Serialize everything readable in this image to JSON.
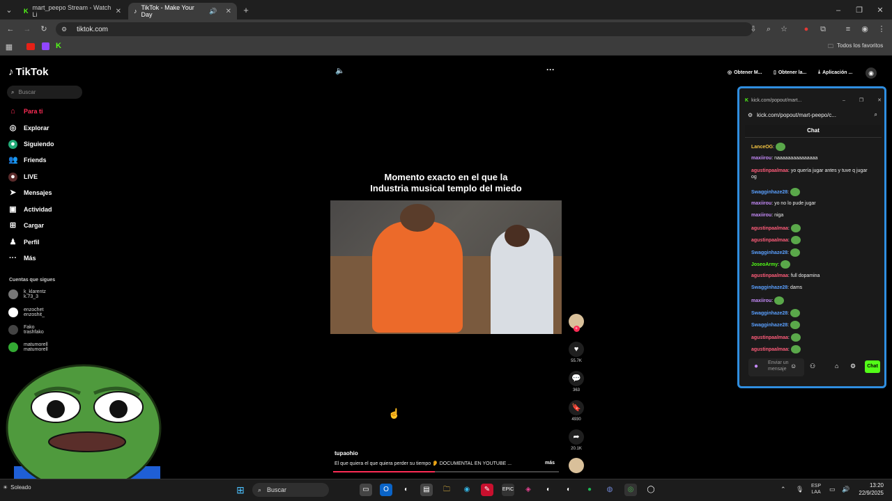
{
  "browser": {
    "tabs": [
      {
        "title": "mart_peepo Stream - Watch Li"
      },
      {
        "title": "TikTok - Make Your Day"
      }
    ],
    "url": "tiktok.com",
    "bookmarks_right": "Todos los favoritos"
  },
  "tiktok": {
    "logo": "TikTok",
    "search_placeholder": "Buscar",
    "nav": [
      {
        "label": "Para ti",
        "icon": "home-icon"
      },
      {
        "label": "Explorar",
        "icon": "compass-icon"
      },
      {
        "label": "Siguiendo",
        "icon": "following-icon"
      },
      {
        "label": "Friends",
        "icon": "friends-icon"
      },
      {
        "label": "LIVE",
        "icon": "live-icon"
      },
      {
        "label": "Mensajes",
        "icon": "messages-icon"
      },
      {
        "label": "Actividad",
        "icon": "activity-icon"
      },
      {
        "label": "Cargar",
        "icon": "upload-icon"
      },
      {
        "label": "Perfil",
        "icon": "profile-icon"
      },
      {
        "label": "Más",
        "icon": "more-icon"
      }
    ],
    "following_header": "Cuentas que sigues",
    "following": [
      {
        "name": "k_klarentz",
        "handle": "k.73_3"
      },
      {
        "name": "enzochet",
        "handle": "enzoshit_"
      },
      {
        "name": "Fako",
        "handle": "trashfako"
      },
      {
        "name": "matumorell",
        "handle": "matumorell"
      }
    ],
    "top_chips": [
      "Obtener M...",
      "Obtener la...",
      "Aplicación ..."
    ],
    "video": {
      "caption_line1": "Momento exacto en el que la",
      "caption_line2": "Industria musical templo del miedo",
      "author": "tupaohio",
      "description": "El que quiera el que quiera perder su tiempo 👂 DOCUMENTAL EN YOUTUBE ...",
      "more": "más",
      "likes": "55.7K",
      "comments": "363",
      "saves": "4930",
      "shares": "20.1K",
      "progress": 0.45
    }
  },
  "kick_popup": {
    "title": "kick.com/popout/mart...",
    "url": "kick.com/popout/mart-peepo/c...",
    "chat_title": "Chat",
    "messages": [
      {
        "user": "LanceOG",
        "text": "",
        "color": "#f5c542"
      },
      {
        "user": "maxiirou",
        "text": "naaaaaaaaaaaaaaa",
        "color": "#c58af9"
      },
      {
        "user": "agustinpaalmaa",
        "text": "yo quería jugar antes y tuve q jugar og",
        "color": "#ff5c7a"
      },
      {
        "user": "Swagginhaze28",
        "text": "",
        "color": "#5aa0ff"
      },
      {
        "user": "maxiirou",
        "text": "yo no lo pude jugar",
        "color": "#c58af9"
      },
      {
        "user": "maxiirou",
        "text": "niga",
        "color": "#c58af9"
      },
      {
        "user": "agustinpaalmaa",
        "text": "",
        "color": "#ff5c7a"
      },
      {
        "user": "agustinpaalmaa",
        "text": "",
        "color": "#ff5c7a"
      },
      {
        "user": "Swagginhaze28",
        "text": "",
        "color": "#5aa0ff"
      },
      {
        "user": "JoseoArmy",
        "text": "",
        "color": "#53fc18"
      },
      {
        "user": "agustinpaalmaa",
        "text": "full dopamina",
        "color": "#ff5c7a"
      },
      {
        "user": "Swagginhaze28",
        "text": "dams",
        "color": "#5aa0ff"
      },
      {
        "user": "maxiirou",
        "text": "",
        "color": "#c58af9"
      },
      {
        "user": "Swagginhaze28",
        "text": "",
        "color": "#5aa0ff"
      },
      {
        "user": "Swagginhaze28",
        "text": "",
        "color": "#5aa0ff"
      },
      {
        "user": "agustinpaalmaa",
        "text": "",
        "color": "#ff5c7a"
      },
      {
        "user": "agustinpaalmaa",
        "text": "",
        "color": "#ff5c7a"
      }
    ],
    "input_placeholder": "Enviar un mensaje",
    "send_label": "Chat"
  },
  "taskbar": {
    "search": "Buscar",
    "lang_line1": "ESP",
    "lang_line2": "LAA",
    "time": "13:20",
    "date": "22/9/2025",
    "weather": "Soleado"
  }
}
